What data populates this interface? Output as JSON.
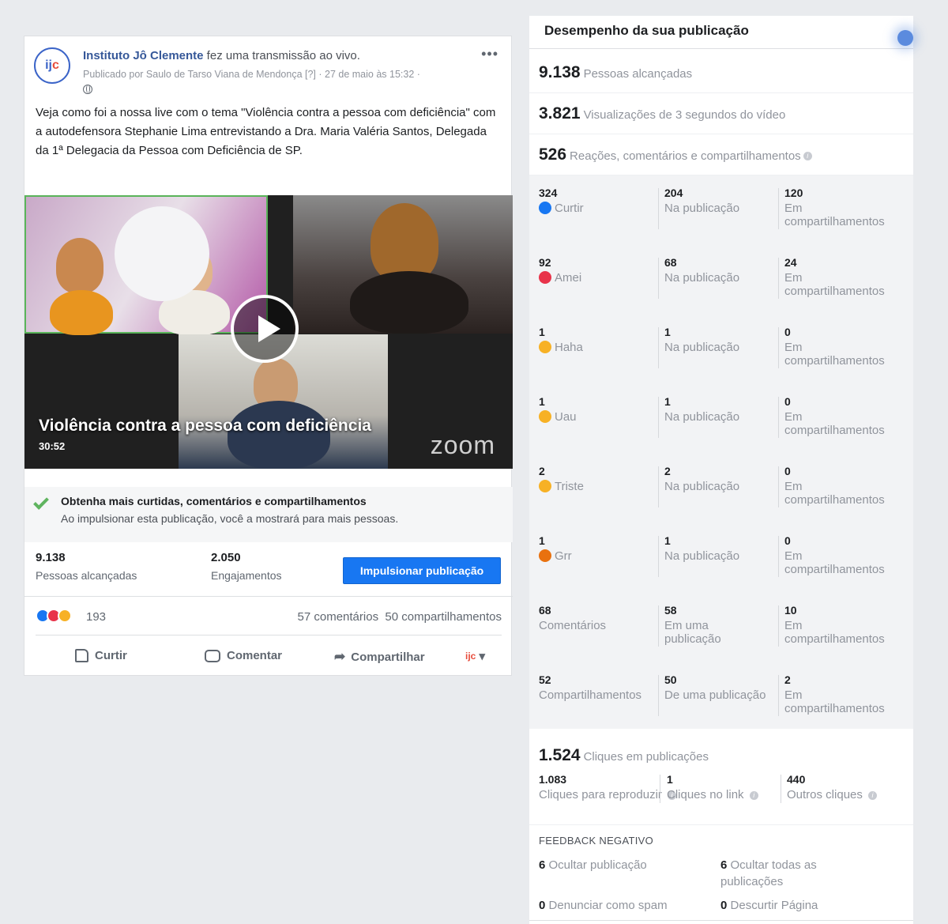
{
  "post": {
    "page_name": "Instituto Jô Clemente",
    "action_text": " fez uma transmissão ao vivo.",
    "byline": "Publicado por Saulo de Tarso Viana de Mendonça [?] · 27 de maio às 15:32 ·",
    "avatar_text_a": "ij",
    "avatar_text_b": "c",
    "text": "Veja como foi a nossa live com o tema \"Violência contra a pessoa com deficiência\" com a autodefensora Stephanie Lima entrevistando a Dra. Maria Valéria Santos, Delegada da 1ª Delegacia da Pessoa com Deficiência de SP.",
    "more_label": "•••"
  },
  "video": {
    "title": "Violência contra a pessoa com deficiência",
    "duration": "30:52",
    "watermark": "zoom"
  },
  "boost_tip": {
    "title": "Obtenha mais curtidas, comentários e compartilhamentos",
    "subtitle": "Ao impulsionar esta publicação, você a mostrará para mais pessoas."
  },
  "stats": {
    "reach_num": "9.138",
    "reach_label": "Pessoas alcançadas",
    "eng_num": "2.050",
    "eng_label": "Engajamentos",
    "boost_button": "Impulsionar publicação"
  },
  "reactions_bar": {
    "count": "193",
    "comments": "57 comentários",
    "shares": "50 compartilhamentos"
  },
  "actions": {
    "like": "Curtir",
    "comment": "Comentar",
    "share": "Compartilhar",
    "page_mini": "ijc",
    "caret": "▾"
  },
  "panel": {
    "title": "Desempenho da sua publicação",
    "reach_num": "9.138",
    "reach_label": "Pessoas alcançadas",
    "views_num": "3.821",
    "views_label": "Visualizações de 3 segundos do vídeo",
    "engage_num": "526",
    "engage_label": "Reações, comentários e compartilhamentos",
    "info_glyph": "i",
    "rows": [
      {
        "total": "324",
        "label": "Curtir",
        "post_num": "204",
        "post_label": "Na publicação",
        "share_num": "120",
        "share_label": "Em compartilhamentos",
        "emoji_color": "#1877f2"
      },
      {
        "total": "92",
        "label": "Amei",
        "post_num": "68",
        "post_label": "Na publicação",
        "share_num": "24",
        "share_label": "Em compartilhamentos",
        "emoji_color": "#e8334a"
      },
      {
        "total": "1",
        "label": "Haha",
        "post_num": "1",
        "post_label": "Na publicação",
        "share_num": "0",
        "share_label": "Em compartilhamentos",
        "emoji_color": "#f7b125"
      },
      {
        "total": "1",
        "label": "Uau",
        "post_num": "1",
        "post_label": "Na publicação",
        "share_num": "0",
        "share_label": "Em compartilhamentos",
        "emoji_color": "#f7b125"
      },
      {
        "total": "2",
        "label": "Triste",
        "post_num": "2",
        "post_label": "Na publicação",
        "share_num": "0",
        "share_label": "Em compartilhamentos",
        "emoji_color": "#f7b125"
      },
      {
        "total": "1",
        "label": "Grr",
        "post_num": "1",
        "post_label": "Na publicação",
        "share_num": "0",
        "share_label": "Em compartilhamentos",
        "emoji_color": "#e9710f"
      },
      {
        "total": "68",
        "label": "Comentários",
        "post_num": "58",
        "post_label": "Em uma publicação",
        "share_num": "10",
        "share_label": "Em compartilhamentos",
        "emoji_color": ""
      },
      {
        "total": "52",
        "label": "Compartilhamentos",
        "post_num": "50",
        "post_label": "De uma publicação",
        "share_num": "2",
        "share_label": "Em compartilhamentos",
        "emoji_color": ""
      }
    ],
    "clicks_num": "1.524",
    "clicks_label": "Cliques em publicações",
    "play_num": "1.083",
    "play_label": "Cliques para reproduzir",
    "link_num": "1",
    "link_label": "Cliques no link",
    "other_num": "440",
    "other_label": "Outros cliques",
    "negative_title": "FEEDBACK NEGATIVO",
    "hide_post_num": "6",
    "hide_post_label": "Ocultar publicação",
    "hide_all_num": "6",
    "hide_all_label": "Ocultar todas as publicações",
    "spam_num": "0",
    "spam_label": "Denunciar como spam",
    "unlike_num": "0",
    "unlike_label": "Descurtir Página"
  }
}
